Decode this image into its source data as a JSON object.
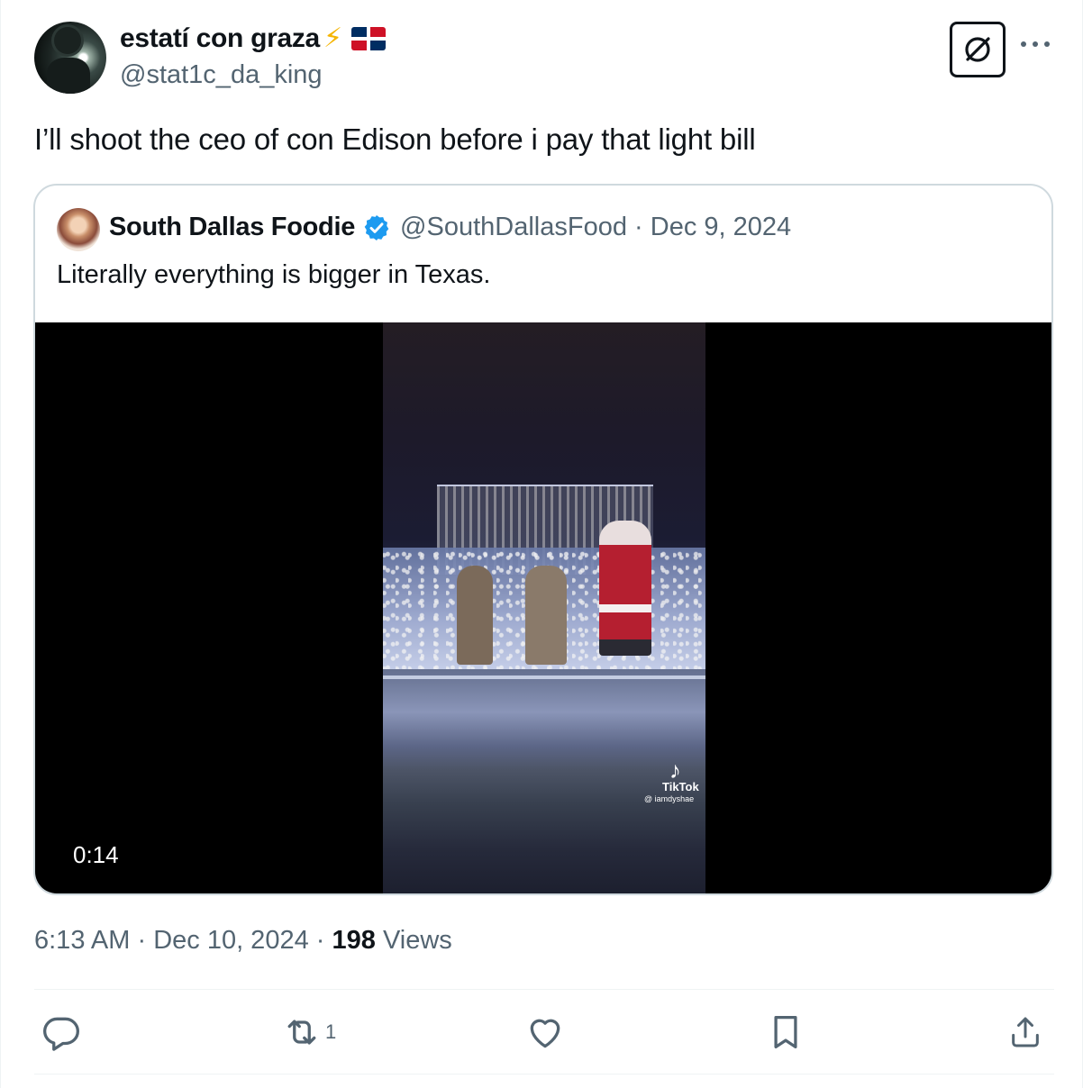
{
  "author": {
    "display_name": "estatí con graza",
    "handle": "@stat1c_da_king",
    "emoji_suffix": "⚡"
  },
  "tweet": {
    "text": "I’ll shoot the ceo of con Edison before i pay that light bill",
    "time": "6:13 AM",
    "date": "Dec 10, 2024",
    "views_count": "198",
    "views_label": "Views"
  },
  "quoted_tweet": {
    "display_name": "South Dallas Foodie",
    "handle": "@SouthDallasFood",
    "date": "Dec 9, 2024",
    "text": "Literally everything is bigger in Texas.",
    "verified": true,
    "video": {
      "duration": "0:14",
      "watermark_brand": "TikTok",
      "watermark_user": "@ iamdyshae"
    }
  },
  "actions": {
    "reply_count": "",
    "retweet_count": "1",
    "like_count": "",
    "bookmark_count": ""
  },
  "colors": {
    "text_primary": "#0f1419",
    "text_secondary": "#536471",
    "border": "#cfd9de",
    "verified_blue": "#1d9bf0",
    "bolt_yellow": "#f5b400"
  },
  "icons": {
    "header": [
      "grok-icon",
      "more-icon"
    ],
    "actions": [
      "reply-icon",
      "retweet-icon",
      "like-icon",
      "bookmark-icon",
      "share-icon"
    ]
  }
}
